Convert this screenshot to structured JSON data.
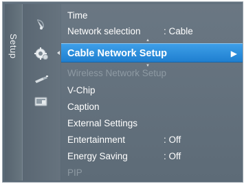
{
  "sidebar": {
    "label": "Setup"
  },
  "icons": [
    {
      "name": "satellite-dish-icon"
    },
    {
      "name": "gear-setup-icon"
    },
    {
      "name": "input-plug-icon"
    },
    {
      "name": "application-icon"
    }
  ],
  "menu": {
    "items": [
      {
        "label": "Time",
        "value": "",
        "state": "normal"
      },
      {
        "label": "Network selection",
        "value": ": Cable",
        "state": "normal"
      },
      {
        "label": "Cable Network Setup",
        "value": "",
        "state": "selected"
      },
      {
        "label": "Wireless Network Setup",
        "value": "",
        "state": "disabled"
      },
      {
        "label": "V-Chip",
        "value": "",
        "state": "normal"
      },
      {
        "label": "Caption",
        "value": "",
        "state": "normal"
      },
      {
        "label": "External Settings",
        "value": "",
        "state": "normal"
      },
      {
        "label": "Entertainment",
        "value": ": Off",
        "state": "normal"
      },
      {
        "label": "Energy Saving",
        "value": ": Off",
        "state": "normal"
      },
      {
        "label": "PIP",
        "value": "",
        "state": "disabled"
      }
    ],
    "selected_arrow": "▶"
  },
  "colors": {
    "highlight": "#2b8fde",
    "panel": "#5f6d79",
    "text": "#ffffff",
    "disabled_text": "#8e9aa3"
  }
}
